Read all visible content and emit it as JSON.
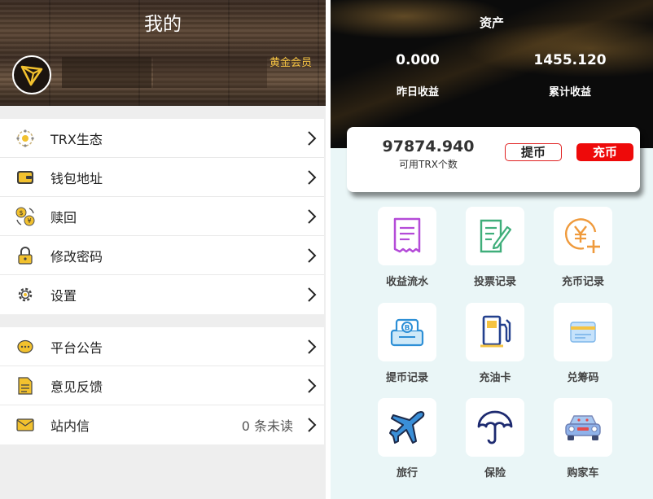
{
  "profile": {
    "title": "我的",
    "member_level": "黄金会员"
  },
  "menu_group1": [
    {
      "label": "TRX生态",
      "icon": "ecosystem-icon"
    },
    {
      "label": "钱包地址",
      "icon": "wallet-icon"
    },
    {
      "label": "赎回",
      "icon": "redeem-coins-icon"
    },
    {
      "label": "修改密码",
      "icon": "lock-icon"
    },
    {
      "label": "设置",
      "icon": "gear-icon"
    }
  ],
  "menu_group2": [
    {
      "label": "平台公告",
      "icon": "announcement-icon"
    },
    {
      "label": "意见反馈",
      "icon": "feedback-icon"
    },
    {
      "label": "站内信",
      "icon": "mail-icon",
      "value": "0 条未读"
    }
  ],
  "assets": {
    "title": "资产",
    "yesterday_value": "0.000",
    "yesterday_label": "昨日收益",
    "total_value": "1455.120",
    "total_label": "累计收益",
    "available_value": "97874.940",
    "available_label": "可用TRX个数",
    "withdraw_label": "提币",
    "deposit_label": "充币"
  },
  "grid": [
    {
      "label": "收益流水",
      "icon": "receipt-icon"
    },
    {
      "label": "投票记录",
      "icon": "vote-record-icon"
    },
    {
      "label": "充币记录",
      "icon": "yen-plus-icon"
    },
    {
      "label": "提币记录",
      "icon": "withdraw-box-icon"
    },
    {
      "label": "充油卡",
      "icon": "fuel-pump-icon"
    },
    {
      "label": "兑筹码",
      "icon": "card-icon"
    },
    {
      "label": "旅行",
      "icon": "airplane-icon"
    },
    {
      "label": "保险",
      "icon": "umbrella-icon"
    },
    {
      "label": "购家车",
      "icon": "car-icon"
    }
  ],
  "colors": {
    "accent_red": "#ee0a0a",
    "member_gold": "#f5c342",
    "tron_gold": "#f2c12e"
  }
}
